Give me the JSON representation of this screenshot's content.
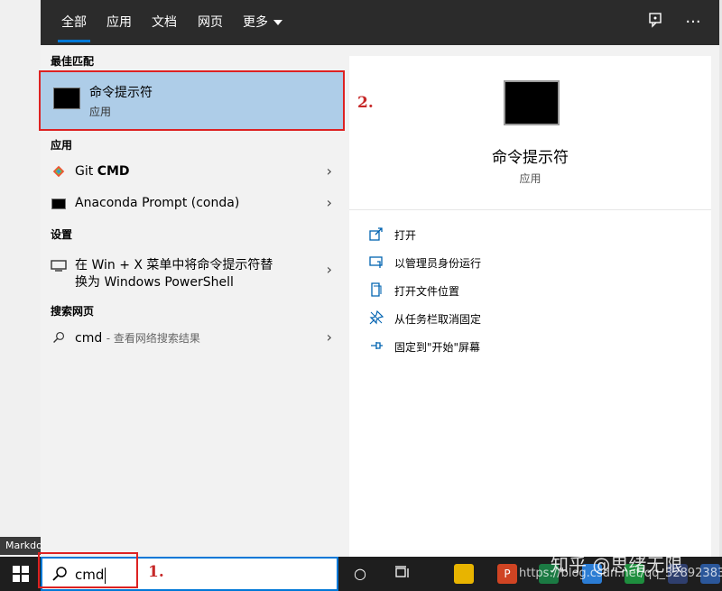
{
  "background": {
    "left_snippet": "Markdo"
  },
  "tabs": [
    {
      "label": "全部"
    },
    {
      "label": "应用"
    },
    {
      "label": "文档"
    },
    {
      "label": "网页"
    },
    {
      "label": "更多"
    }
  ],
  "sections": {
    "best_match": "最佳匹配",
    "apps": "应用",
    "settings": "设置",
    "web": "搜索网页"
  },
  "best_match": {
    "title": "命令提示符",
    "subtitle": "应用"
  },
  "apps": [
    {
      "name": "Git",
      "name_bold": "CMD"
    },
    {
      "name": "Anaconda Prompt (conda)"
    }
  ],
  "setting_item": {
    "line1": "在 Win + X 菜单中将命令提示符替",
    "line2": "换为 Windows PowerShell"
  },
  "web_item": {
    "query": "cmd",
    "hint": "- 查看网络搜索结果"
  },
  "preview": {
    "title": "命令提示符",
    "subtitle": "应用",
    "actions": [
      {
        "label": "打开",
        "icon": "open-icon"
      },
      {
        "label": "以管理员身份运行",
        "icon": "run-as-admin-icon"
      },
      {
        "label": "打开文件位置",
        "icon": "file-location-icon"
      },
      {
        "label": "从任务栏取消固定",
        "icon": "unpin-taskbar-icon"
      },
      {
        "label": "固定到\"开始\"屏幕",
        "icon": "pin-start-icon"
      }
    ]
  },
  "search": {
    "value": "cmd"
  },
  "annotations": {
    "one": "1.",
    "two": "2."
  },
  "watermark": {
    "main": "知乎 @思绪无限",
    "sub": "https://blog.csdn.net/qq_32892383"
  },
  "colors": {
    "accent": "#0078d7",
    "selected": "#aecde8",
    "annotation": "#c62828",
    "topbar": "#2b2b2b"
  }
}
